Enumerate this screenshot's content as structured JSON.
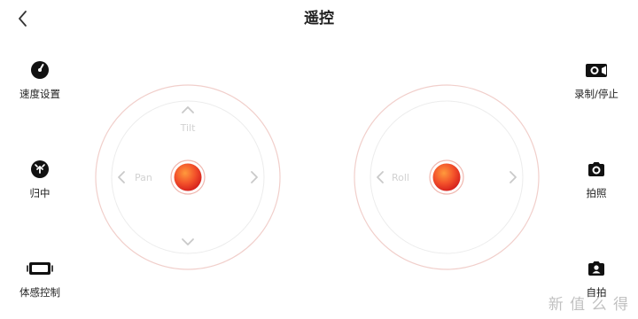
{
  "header": {
    "title": "遥控"
  },
  "left_actions": [
    {
      "label": "速度设置",
      "icon": "speedometer-icon"
    },
    {
      "label": "归中",
      "icon": "recenter-icon"
    },
    {
      "label": "体感控制",
      "icon": "phone-motion-icon"
    }
  ],
  "right_actions": [
    {
      "label": "录制/停止",
      "icon": "video-camera-icon"
    },
    {
      "label": "拍照",
      "icon": "camera-icon"
    },
    {
      "label": "自拍",
      "icon": "selfie-icon"
    }
  ],
  "joystick_left": {
    "up_label": "Tilt",
    "left_label": "Pan"
  },
  "joystick_right": {
    "left_label": "Roll"
  },
  "watermark": "新 值 么 得",
  "colors": {
    "accent": "#e8341f",
    "ring": "#f1cfcb",
    "arrow": "#c9c9c9"
  }
}
